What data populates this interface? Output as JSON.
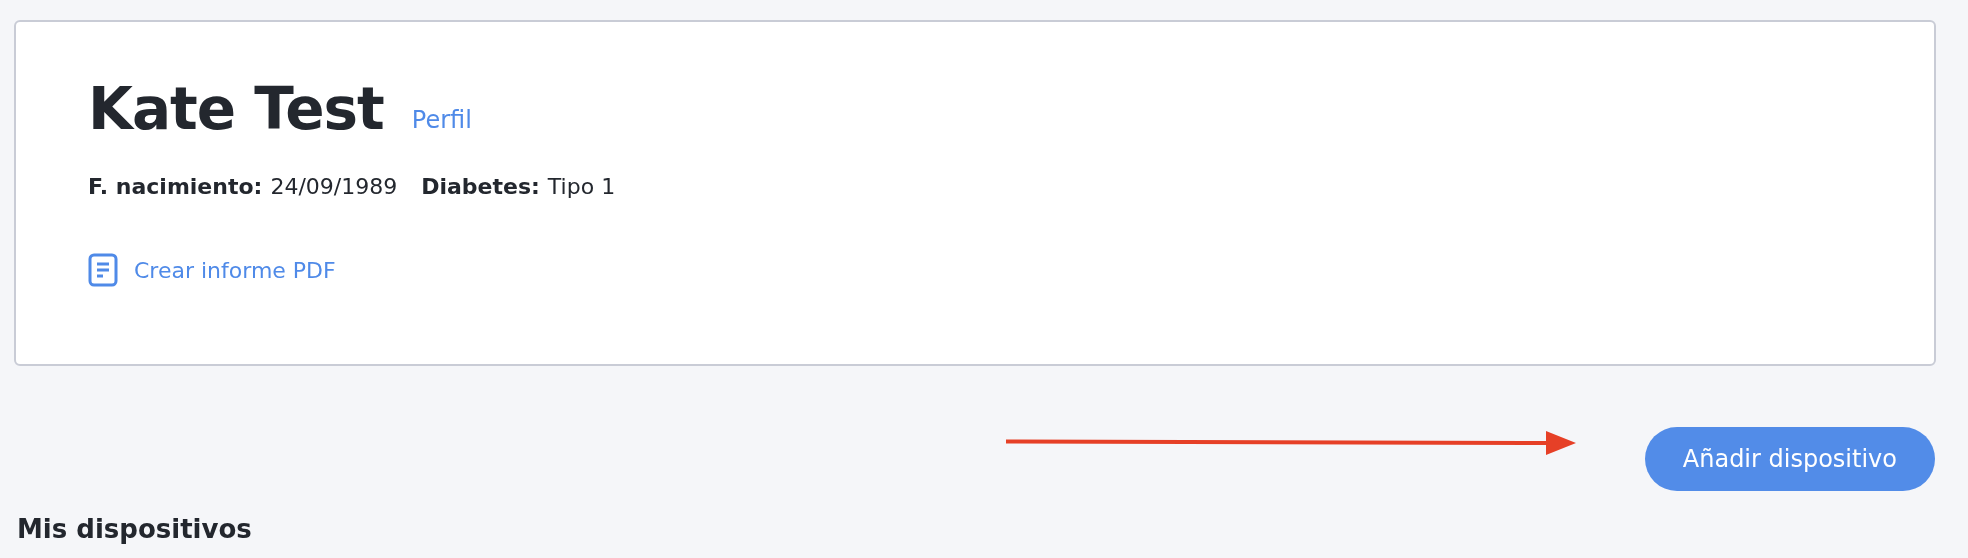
{
  "patient": {
    "name": "Kate Test",
    "profile_link": "Perfil",
    "fields": [
      {
        "label": "F. nacimiento:",
        "value": "24/09/1989"
      },
      {
        "label": "Diabetes:",
        "value": "Tipo 1"
      }
    ],
    "report_link": "Crear informe PDF"
  },
  "add_device_button": "Añadir dispositivo",
  "devices_heading": "Mis dispositivos"
}
